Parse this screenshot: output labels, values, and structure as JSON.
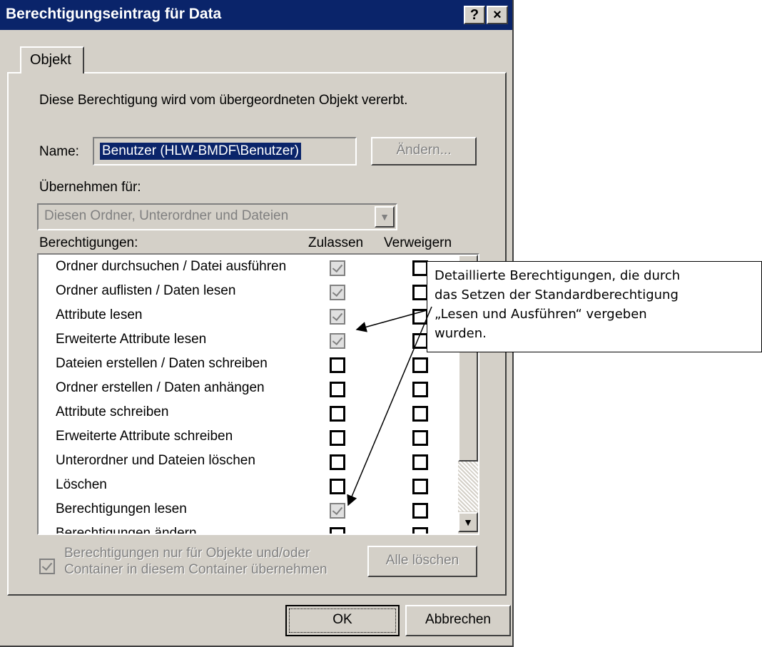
{
  "window": {
    "title": "Berechtigungseintrag für Data",
    "help_button": "?",
    "close_button": "×"
  },
  "tab": {
    "label": "Objekt"
  },
  "info_text": "Diese Berechtigung wird vom übergeordneten Objekt vererbt.",
  "name": {
    "label": "Name:",
    "value": "Benutzer (HLW-BMDF\\Benutzer)",
    "change_button": "Ändern..."
  },
  "apply_to": {
    "label": "Übernehmen für:",
    "selected": "Diesen Ordner, Unterordner und Dateien"
  },
  "permissions": {
    "label": "Berechtigungen:",
    "col_allow": "Zulassen",
    "col_deny": "Verweigern",
    "rows": [
      {
        "label": "Ordner durchsuchen / Datei ausführen",
        "allow": true,
        "deny": false
      },
      {
        "label": "Ordner auflisten / Daten lesen",
        "allow": true,
        "deny": false
      },
      {
        "label": "Attribute lesen",
        "allow": true,
        "deny": false
      },
      {
        "label": "Erweiterte Attribute lesen",
        "allow": true,
        "deny": false
      },
      {
        "label": "Dateien erstellen / Daten schreiben",
        "allow": false,
        "deny": false
      },
      {
        "label": "Ordner erstellen / Daten anhängen",
        "allow": false,
        "deny": false
      },
      {
        "label": "Attribute schreiben",
        "allow": false,
        "deny": false
      },
      {
        "label": "Erweiterte Attribute schreiben",
        "allow": false,
        "deny": false
      },
      {
        "label": "Unterordner und Dateien löschen",
        "allow": false,
        "deny": false
      },
      {
        "label": "Löschen",
        "allow": false,
        "deny": false
      },
      {
        "label": "Berechtigungen lesen",
        "allow": true,
        "deny": false
      },
      {
        "label": "Berechtigungen ändern",
        "allow": false,
        "deny": false
      }
    ]
  },
  "inherit_checkbox": {
    "line1": "Berechtigungen nur für Objekte und/oder",
    "line2": "Container in diesem Container übernehmen"
  },
  "clear_all_button": "Alle löschen",
  "ok_button": "OK",
  "cancel_button": "Abbrechen",
  "callout": {
    "line1": "Detaillierte Berechtigungen, die durch",
    "line2": "das Setzen der Standardberechtigung",
    "line3": "„Lesen und Ausführen“ vergeben",
    "line4": "wurden."
  }
}
